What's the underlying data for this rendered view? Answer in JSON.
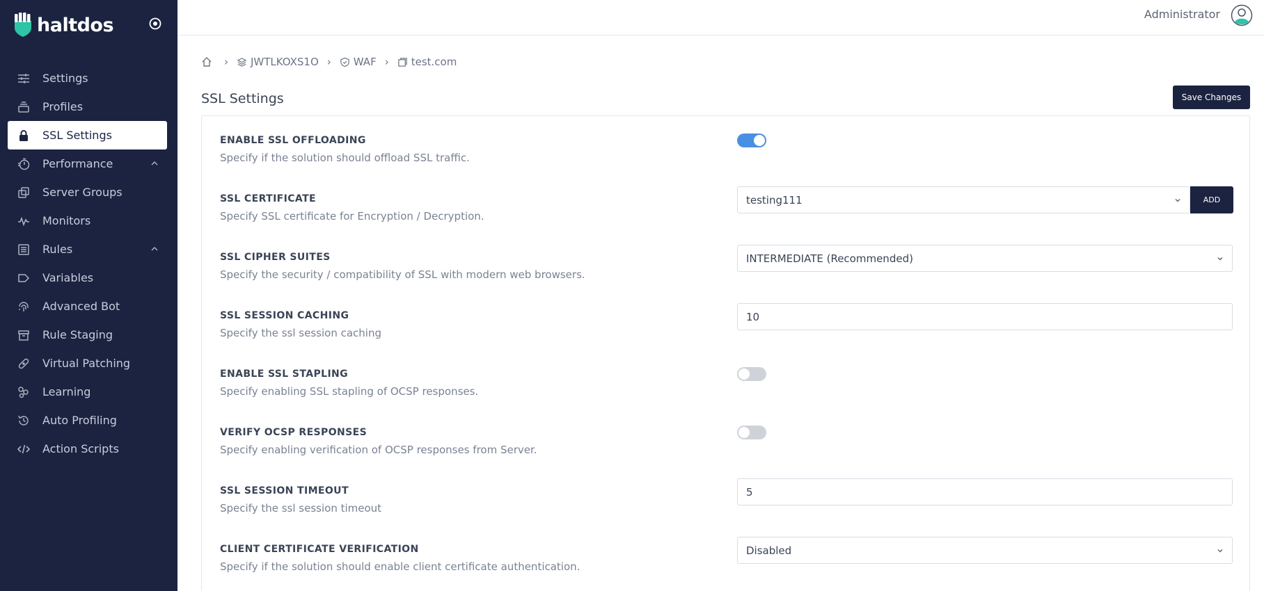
{
  "brand": {
    "name": "haltdos"
  },
  "sidebar": {
    "items": [
      {
        "label": "Settings",
        "icon": "sliders-icon"
      },
      {
        "label": "Profiles",
        "icon": "stack-icon"
      },
      {
        "label": "SSL Settings",
        "icon": "lock-icon",
        "active": true
      },
      {
        "label": "Performance",
        "icon": "stopwatch-icon",
        "expandable": true
      },
      {
        "label": "Server Groups",
        "icon": "copy-icon"
      },
      {
        "label": "Monitors",
        "icon": "pulse-icon"
      },
      {
        "label": "Rules",
        "icon": "list-icon",
        "expandable": true
      },
      {
        "label": "Variables",
        "icon": "tag-icon"
      },
      {
        "label": "Advanced Bot",
        "icon": "fingerprint-icon"
      },
      {
        "label": "Rule Staging",
        "icon": "archive-icon"
      },
      {
        "label": "Virtual Patching",
        "icon": "bandaid-icon"
      },
      {
        "label": "Learning",
        "icon": "molecule-icon"
      },
      {
        "label": "Auto Profiling",
        "icon": "history-icon"
      },
      {
        "label": "Action Scripts",
        "icon": "code-icon"
      }
    ]
  },
  "topbar": {
    "user": "Administrator"
  },
  "breadcrumb": {
    "node": "JWTLKOXS1O",
    "module": "WAF",
    "site": "test.com"
  },
  "page": {
    "title": "SSL Settings",
    "save_label": "Save Changes"
  },
  "settings": {
    "ssl_offloading": {
      "title": "ENABLE SSL OFFLOADING",
      "desc": "Specify if the solution should offload SSL traffic.",
      "enabled": true
    },
    "ssl_certificate": {
      "title": "SSL CERTIFICATE",
      "desc": "Specify SSL certificate for Encryption / Decryption.",
      "value": "testing111",
      "add_label": "ADD"
    },
    "cipher_suites": {
      "title": "SSL CIPHER SUITES",
      "desc": "Specify the security / compatibility of SSL with modern web browsers.",
      "value": "INTERMEDIATE (Recommended)"
    },
    "session_caching": {
      "title": "SSL SESSION CACHING",
      "desc": "Specify the ssl session caching",
      "value": "10"
    },
    "ssl_stapling": {
      "title": "ENABLE SSL STAPLING",
      "desc": "Specify enabling SSL stapling of OCSP responses.",
      "enabled": false
    },
    "verify_ocsp": {
      "title": "VERIFY OCSP RESPONSES",
      "desc": "Specify enabling verification of OCSP responses from Server.",
      "enabled": false
    },
    "session_timeout": {
      "title": "SSL SESSION TIMEOUT",
      "desc": "Specify the ssl session timeout",
      "value": "5"
    },
    "client_cert": {
      "title": "CLIENT CERTIFICATE VERIFICATION",
      "desc": "Specify if the solution should enable client certificate authentication.",
      "value": "Disabled"
    }
  },
  "colors": {
    "sidebar_bg": "#1b2340",
    "accent": "#4a90e2",
    "logo_teal": "#2ec4a6"
  }
}
